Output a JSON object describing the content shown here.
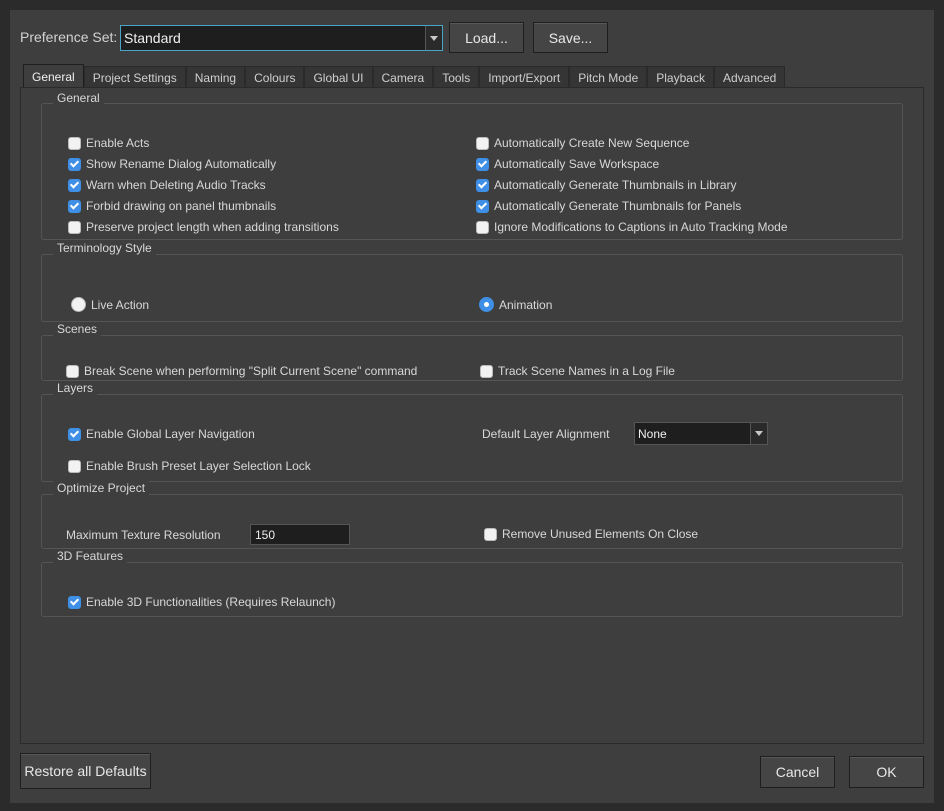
{
  "preference_set": {
    "label": "Preference Set:",
    "value": "Standard",
    "load_label": "Load...",
    "save_label": "Save..."
  },
  "tabs": [
    "General",
    "Project Settings",
    "Naming",
    "Colours",
    "Global UI",
    "Camera",
    "Tools",
    "Import/Export",
    "Pitch Mode",
    "Playback",
    "Advanced"
  ],
  "active_tab": "General",
  "general": {
    "title": "General",
    "left": [
      {
        "label": "Enable Acts",
        "checked": false
      },
      {
        "label": "Show Rename Dialog Automatically",
        "checked": true
      },
      {
        "label": "Warn when Deleting Audio Tracks",
        "checked": true
      },
      {
        "label": "Forbid drawing on panel thumbnails",
        "checked": true
      },
      {
        "label": "Preserve project length when adding transitions",
        "checked": false
      }
    ],
    "right": [
      {
        "label": "Automatically Create New Sequence",
        "checked": false
      },
      {
        "label": "Automatically Save Workspace",
        "checked": true
      },
      {
        "label": "Automatically Generate Thumbnails in Library",
        "checked": true
      },
      {
        "label": "Automatically Generate Thumbnails for Panels",
        "checked": true
      },
      {
        "label": "Ignore Modifications to Captions in Auto Tracking Mode",
        "checked": false
      }
    ]
  },
  "terminology": {
    "title": "Terminology Style",
    "live_action": "Live Action",
    "animation": "Animation",
    "selected": "Animation"
  },
  "scenes": {
    "title": "Scenes",
    "break_scene": "Break Scene when performing \"Split Current Scene\" command",
    "track_names": "Track Scene Names in a Log File"
  },
  "layers": {
    "title": "Layers",
    "global_nav": "Enable Global Layer Navigation",
    "brush_lock": "Enable Brush Preset Layer Selection Lock",
    "alignment_label": "Default Layer Alignment",
    "alignment_value": "None"
  },
  "optimize": {
    "title": "Optimize Project",
    "max_texture_label": "Maximum Texture Resolution",
    "max_texture_value": "150",
    "remove_unused": "Remove Unused Elements On Close"
  },
  "features3d": {
    "title": "3D Features",
    "enable": "Enable 3D Functionalities (Requires Relaunch)"
  },
  "footer": {
    "restore": "Restore all Defaults",
    "cancel": "Cancel",
    "ok": "OK"
  }
}
